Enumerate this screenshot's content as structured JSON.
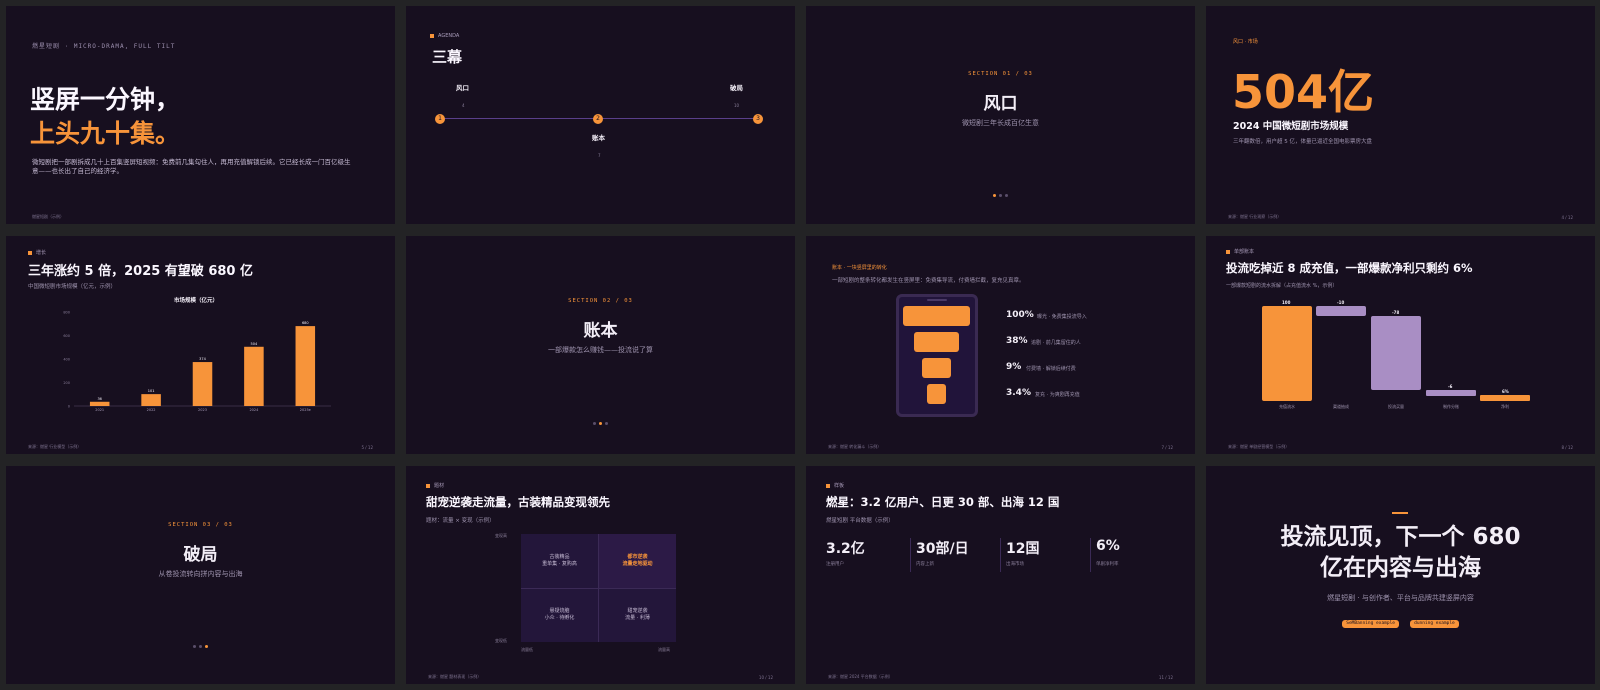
{
  "colors": {
    "bg": "#170f1f",
    "accent": "#f7943a",
    "lilac": "#a98ec4",
    "muted": "#9e93ae"
  },
  "s1": {
    "kicker": "燃星短剧 · MICRO-DRAMA, FULL TILT",
    "line1": "竖屏一分钟，",
    "line2": "上头九十集。",
    "body": "微短剧把一部剧拆成几十上百集竖屏短视频：免费前几集勾住人，再用充值解锁后续。它已经长成一门百亿级生意——也长出了自己的经济学。",
    "foot": "燃星短剧（示例）"
  },
  "s2": {
    "eyebrow": "AGENDA",
    "title": "三幕",
    "items": [
      {
        "label": "风口",
        "n": "4",
        "marker": "1"
      },
      {
        "label": "账本",
        "n": "7",
        "marker": "2"
      },
      {
        "label": "破局",
        "n": "10",
        "marker": "3"
      }
    ]
  },
  "s3": {
    "section": "SECTION 01 / 03",
    "title": "风口",
    "sub": "微短剧三年长成百亿生意"
  },
  "s4": {
    "eyebrow": "风口 · 市场",
    "big": "504亿",
    "title": "2024 中国微短剧市场规模",
    "sub": "三年翻数倍，用户超 5 亿，体量已逼近全国电影票房大盘",
    "foot": "来源：燃星 行业观察（示例）",
    "num": "4 / 12"
  },
  "s5": {
    "eyebrow": "增长",
    "title": "三年涨约 5 倍，2025 有望破 680 亿",
    "sub": "中国微短剧市场规模（亿元，示例）",
    "foot": "来源：燃星 行业模型（示例）",
    "num": "5 / 12"
  },
  "chart_data": {
    "type": "bar",
    "title": "市场规模（亿元）",
    "categories": [
      "2021",
      "2022",
      "2023",
      "2024",
      "2025e"
    ],
    "values": [
      36,
      101,
      374,
      504,
      680
    ],
    "ylim": [
      0,
      800
    ],
    "yticks": [
      "0",
      "200",
      "400",
      "600",
      "800"
    ],
    "color": "#f7943a"
  },
  "s6": {
    "section": "SECTION 02 / 03",
    "title": "账本",
    "sub": "一部爆款怎么赚钱——投流说了算"
  },
  "s7": {
    "eyebrow": "账本 · 一块竖屏里的转化",
    "sub": "一部短剧的整条转化都发生在竖屏里：免费集导流，付费墙拦截，复充见真章。",
    "rows": [
      {
        "pct": "100%",
        "desc": "曝光 · 免费集投流导入"
      },
      {
        "pct": "38%",
        "desc": "追剧 · 前几集留住的人"
      },
      {
        "pct": "9%",
        "desc": "付费墙 · 解锁后续付费"
      },
      {
        "pct": "3.4%",
        "desc": "复充 · 为爽剧再充值"
      }
    ],
    "foot": "来源：燃星 转化漏斗（示例）",
    "num": "7 / 12"
  },
  "s8": {
    "eyebrow": "单部账本",
    "title": "投流吃掉近 8 成充值，一部爆款净利只剩约 6%",
    "sub": "一部爆款短剧的流水拆解（占充值流水 %，示例）",
    "bars": [
      {
        "label": "充值流水",
        "value": "100"
      },
      {
        "label": "渠道抽成",
        "value": "-10"
      },
      {
        "label": "投流买量",
        "value": "-78"
      },
      {
        "label": "制作分账",
        "value": "-6"
      },
      {
        "label": "净利",
        "value": "6%"
      }
    ],
    "foot": "来源：燃星 单剧经营模型（示例）",
    "num": "8 / 12"
  },
  "s9": {
    "section": "SECTION 03 / 03",
    "title": "破局",
    "sub": "从卷投流转向拼内容与出海"
  },
  "s10": {
    "eyebrow": "题材",
    "title": "甜宠逆袭走流量，古装精品变现领先",
    "sub": "题材：流量 × 变现（示例）",
    "quads": [
      {
        "a": "古装精品",
        "b": "重单集 · 复购高"
      },
      {
        "a": "都市逆袭",
        "b": "流量走地驱动"
      },
      {
        "a": "悬疑烧脑",
        "b": "小众 · 待孵化"
      },
      {
        "a": "甜宠逆袭",
        "b": "流量 · 利薄"
      }
    ],
    "ytop": "变现高",
    "ybot": "变现低",
    "xleft": "流量低",
    "xright": "流量高",
    "foot": "来源：燃星 题材表现（示例）",
    "num": "10 / 12"
  },
  "s11": {
    "eyebrow": "样板",
    "title": "燃星：3.2 亿用户、日更 30 部、出海 12 国",
    "sub": "燃星短剧 平台数据（示例）",
    "stats": [
      {
        "v": "3.2亿",
        "l": "注册用户"
      },
      {
        "v": "30部/日",
        "l": "内容上新"
      },
      {
        "v": "12国",
        "l": "出海市场"
      },
      {
        "v": "6%",
        "l": "单剧净利率"
      }
    ],
    "foot": "来源：燃星 2024 平台数据（示例）",
    "num": "11 / 12"
  },
  "s12": {
    "line1": "投流见顶，下一个 680",
    "line2": "亿在内容与出海",
    "sub": "燃星短剧 · 与创作者、平台与品牌共建竖屏内容",
    "tag1": "SeMBanning example",
    "tag2": "dunning example"
  }
}
